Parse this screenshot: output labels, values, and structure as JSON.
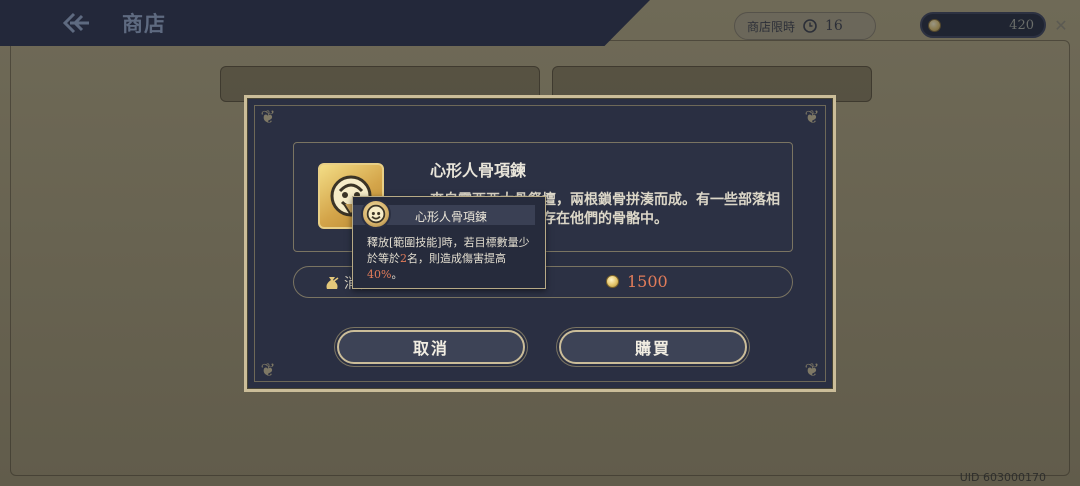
{
  "header": {
    "title": "商店",
    "shop_limit_label": "商店限時",
    "shop_limit_value": "16",
    "currency_amount": "420"
  },
  "dialog": {
    "item_name": "心形人骨項鍊",
    "item_description": "來自露西亞大骨祭壇，兩根鎖骨拼湊而成。有一些部落相信，祖先的靈魂留存在他們的骨骼中。",
    "cost_label": "消耗",
    "cost_value": "1500",
    "cancel_label": "取消",
    "buy_label": "購買"
  },
  "tooltip": {
    "title": "心形人骨項鍊",
    "text_before": "釋放[範圍技能]時，若目標數量少於等於",
    "count": "2",
    "text_middle": "名，則造成傷害提高",
    "percent": "40%",
    "text_after": "。"
  },
  "footer": {
    "uid": "UID 603000170"
  },
  "colors": {
    "accent_gold": "#cbbd99",
    "highlight_red": "#e27c5a",
    "dialog_bg": "#2a2f42"
  },
  "icons": [
    "back-arrow-icon",
    "clock-icon",
    "coin-icon",
    "necklace-icon",
    "money-bag-icon",
    "corner-ornament-icon"
  ]
}
